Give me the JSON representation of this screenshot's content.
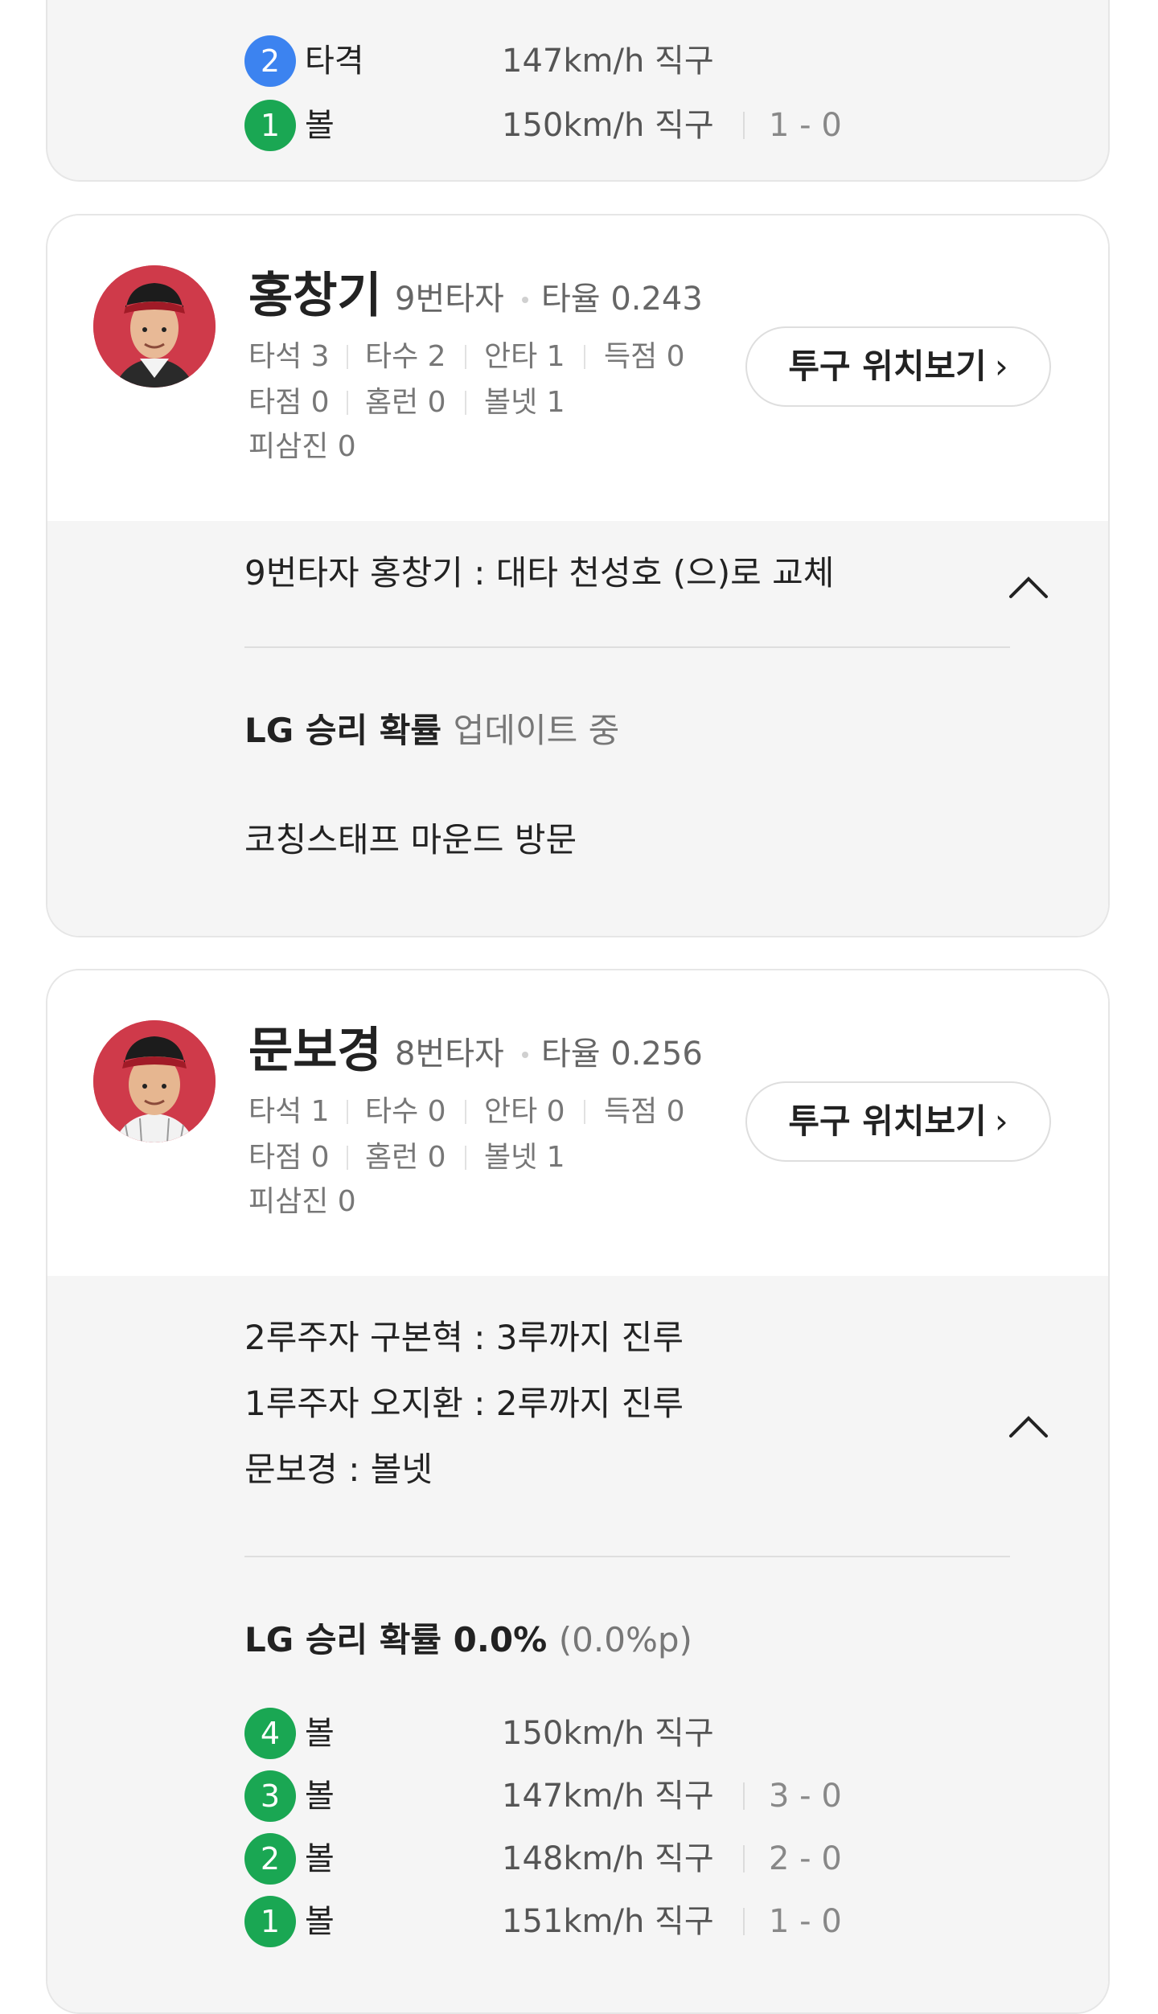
{
  "card0": {
    "pitches": [
      {
        "num": "2",
        "color": "blue",
        "type": "타격",
        "speed": "147km/h",
        "pitch": "직구",
        "count": ""
      },
      {
        "num": "1",
        "color": "green",
        "type": "볼",
        "speed": "150km/h",
        "pitch": "직구",
        "count": "1 - 0"
      }
    ]
  },
  "card1": {
    "name": "홍창기",
    "order": "9번타자",
    "avg_label": "타율 0.243",
    "stats": {
      "ab": "타석 3",
      "at_bat": "타수 2",
      "hit": "안타 1",
      "run": "득점 0",
      "rbi": "타점 0",
      "hr": "홈런 0",
      "bb": "볼넷 1",
      "so": "피삼진 0"
    },
    "button": "투구 위치보기",
    "events": [
      "9번타자 홍창기 : 대타 천성호 (으)로 교체"
    ],
    "prob_label": "LG 승리 확률",
    "prob_value": "업데이트 중",
    "note": "코칭스태프 마운드 방문"
  },
  "card2": {
    "name": "문보경",
    "order": "8번타자",
    "avg_label": "타율 0.256",
    "stats": {
      "ab": "타석 1",
      "at_bat": "타수 0",
      "hit": "안타 0",
      "run": "득점 0",
      "rbi": "타점 0",
      "hr": "홈런 0",
      "bb": "볼넷 1",
      "so": "피삼진 0"
    },
    "button": "투구 위치보기",
    "events": [
      "2루주자 구본혁 : 3루까지 진루",
      "1루주자 오지환 : 2루까지 진루",
      "문보경 : 볼넷"
    ],
    "prob_label": "LG 승리 확률 0.0%",
    "prob_change": "(0.0%p)",
    "pitches": [
      {
        "num": "4",
        "color": "green",
        "type": "볼",
        "speed": "150km/h",
        "pitch": "직구",
        "count": ""
      },
      {
        "num": "3",
        "color": "green",
        "type": "볼",
        "speed": "147km/h",
        "pitch": "직구",
        "count": "3 - 0"
      },
      {
        "num": "2",
        "color": "green",
        "type": "볼",
        "speed": "148km/h",
        "pitch": "직구",
        "count": "2 - 0"
      },
      {
        "num": "1",
        "color": "green",
        "type": "볼",
        "speed": "151km/h",
        "pitch": "직구",
        "count": "1 - 0"
      }
    ]
  },
  "icons": {
    "chevron_right": "chevron-right-icon",
    "chevron_up": "chevron-up-icon"
  }
}
